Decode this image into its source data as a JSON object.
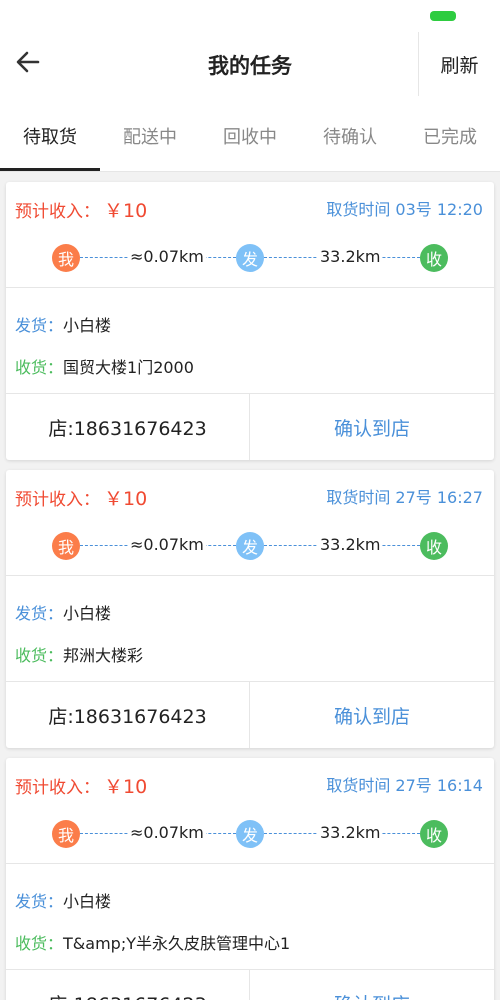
{
  "header": {
    "title": "我的任务",
    "refresh_label": "刷新"
  },
  "tabs": [
    {
      "label": "待取货",
      "active": true
    },
    {
      "label": "配送中"
    },
    {
      "label": "回收中"
    },
    {
      "label": "待确认"
    },
    {
      "label": "已完成"
    }
  ],
  "labels": {
    "income_prefix": "预计收入：",
    "send_prefix": "发货：",
    "recv_prefix": "收货：",
    "me": "我",
    "send": "发",
    "recv": "收",
    "confirm": "确认到店"
  },
  "colors": {
    "income": "#f04a32",
    "accent": "#4a90d9",
    "me_dot": "#fb7d4a",
    "send_dot": "#7fc1f7",
    "recv_dot": "#4cbc5e"
  },
  "orders": [
    {
      "income": "￥10",
      "pickup_time": "取货时间 03号 12:20",
      "dist_me_send": "≈0.07km",
      "dist_send_recv": "33.2km",
      "send_addr": "小白楼",
      "recv_addr": "国贸大楼1门2000",
      "phone": "店:18631676423"
    },
    {
      "income": "￥10",
      "pickup_time": "取货时间 27号 16:27",
      "dist_me_send": "≈0.07km",
      "dist_send_recv": "33.2km",
      "send_addr": "小白楼",
      "recv_addr": "邦洲大楼彩",
      "phone": "店:18631676423"
    },
    {
      "income": "￥10",
      "pickup_time": "取货时间 27号 16:14",
      "dist_me_send": "≈0.07km",
      "dist_send_recv": "33.2km",
      "send_addr": "小白楼",
      "recv_addr": "T&amp;Y半永久皮肤管理中心1",
      "phone": "店:18631676423"
    }
  ]
}
